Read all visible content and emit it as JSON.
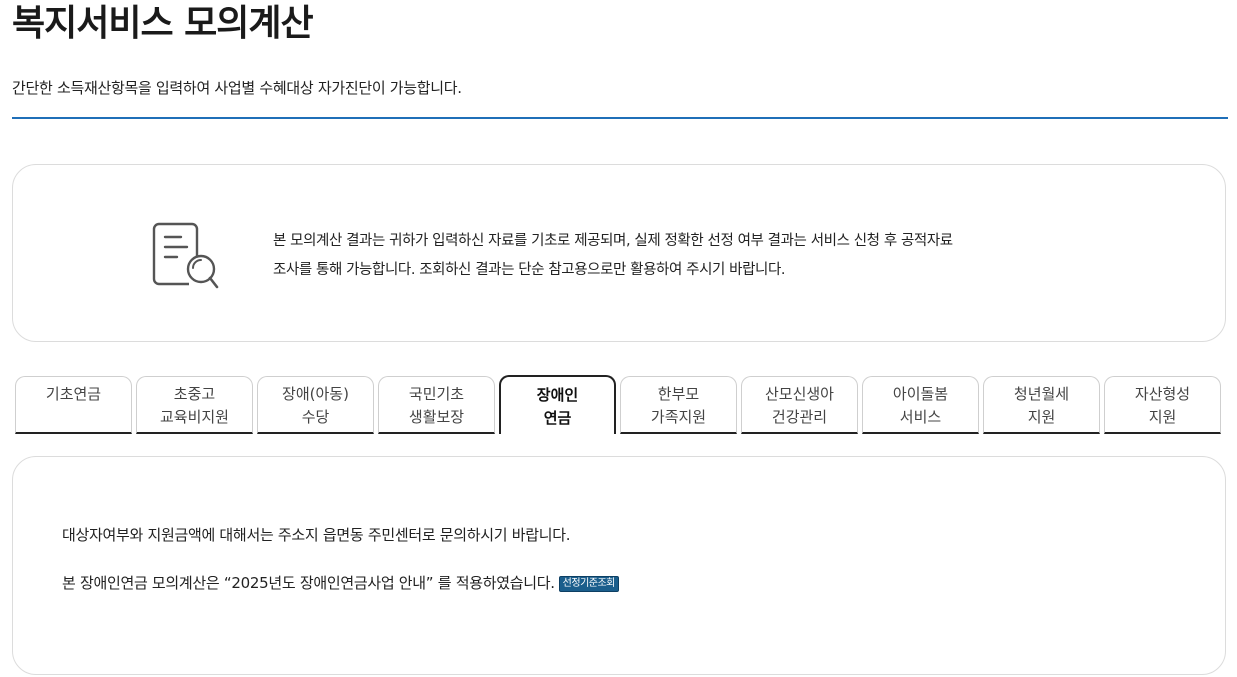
{
  "header": {
    "title": "복지서비스 모의계산",
    "subtitle": "간단한 소득재산항목을 입력하여 사업별 수혜대상 자가진단이 가능합니다."
  },
  "notice": {
    "icon": "document-search-icon",
    "line1": "본 모의계산 결과는 귀하가 입력하신 자료를 기초로 제공되며, 실제 정확한 선정 여부 결과는 서비스 신청 후 공적자료",
    "line2": "조사를 통해 가능합니다. 조회하신 결과는 단순 참고용으로만 활용하여 주시기 바랍니다."
  },
  "tabs": [
    {
      "line1": "기초연금",
      "line2": ""
    },
    {
      "line1": "초중고",
      "line2": "교육비지원"
    },
    {
      "line1": "장애(아동)",
      "line2": "수당"
    },
    {
      "line1": "국민기초",
      "line2": "생활보장"
    },
    {
      "line1": "장애인",
      "line2": "연금",
      "active": true
    },
    {
      "line1": "한부모",
      "line2": "가족지원"
    },
    {
      "line1": "산모신생아",
      "line2": "건강관리"
    },
    {
      "line1": "아이돌봄",
      "line2": "서비스"
    },
    {
      "line1": "청년월세",
      "line2": "지원"
    },
    {
      "line1": "자산형성",
      "line2": "지원"
    }
  ],
  "content": {
    "line1": "대상자여부와 지원금액에 대해서는 주소지 읍면동 주민센터로 문의하시기 바랍니다.",
    "line2": "본 장애인연금 모의계산은 “2025년도 장애인연금사업 안내” 를 적용하였습니다.",
    "criteria_button": "선정기준조회"
  },
  "colors": {
    "accent_rule": "#1f6fb8",
    "criteria_button_bg": "#1b5e8c"
  }
}
